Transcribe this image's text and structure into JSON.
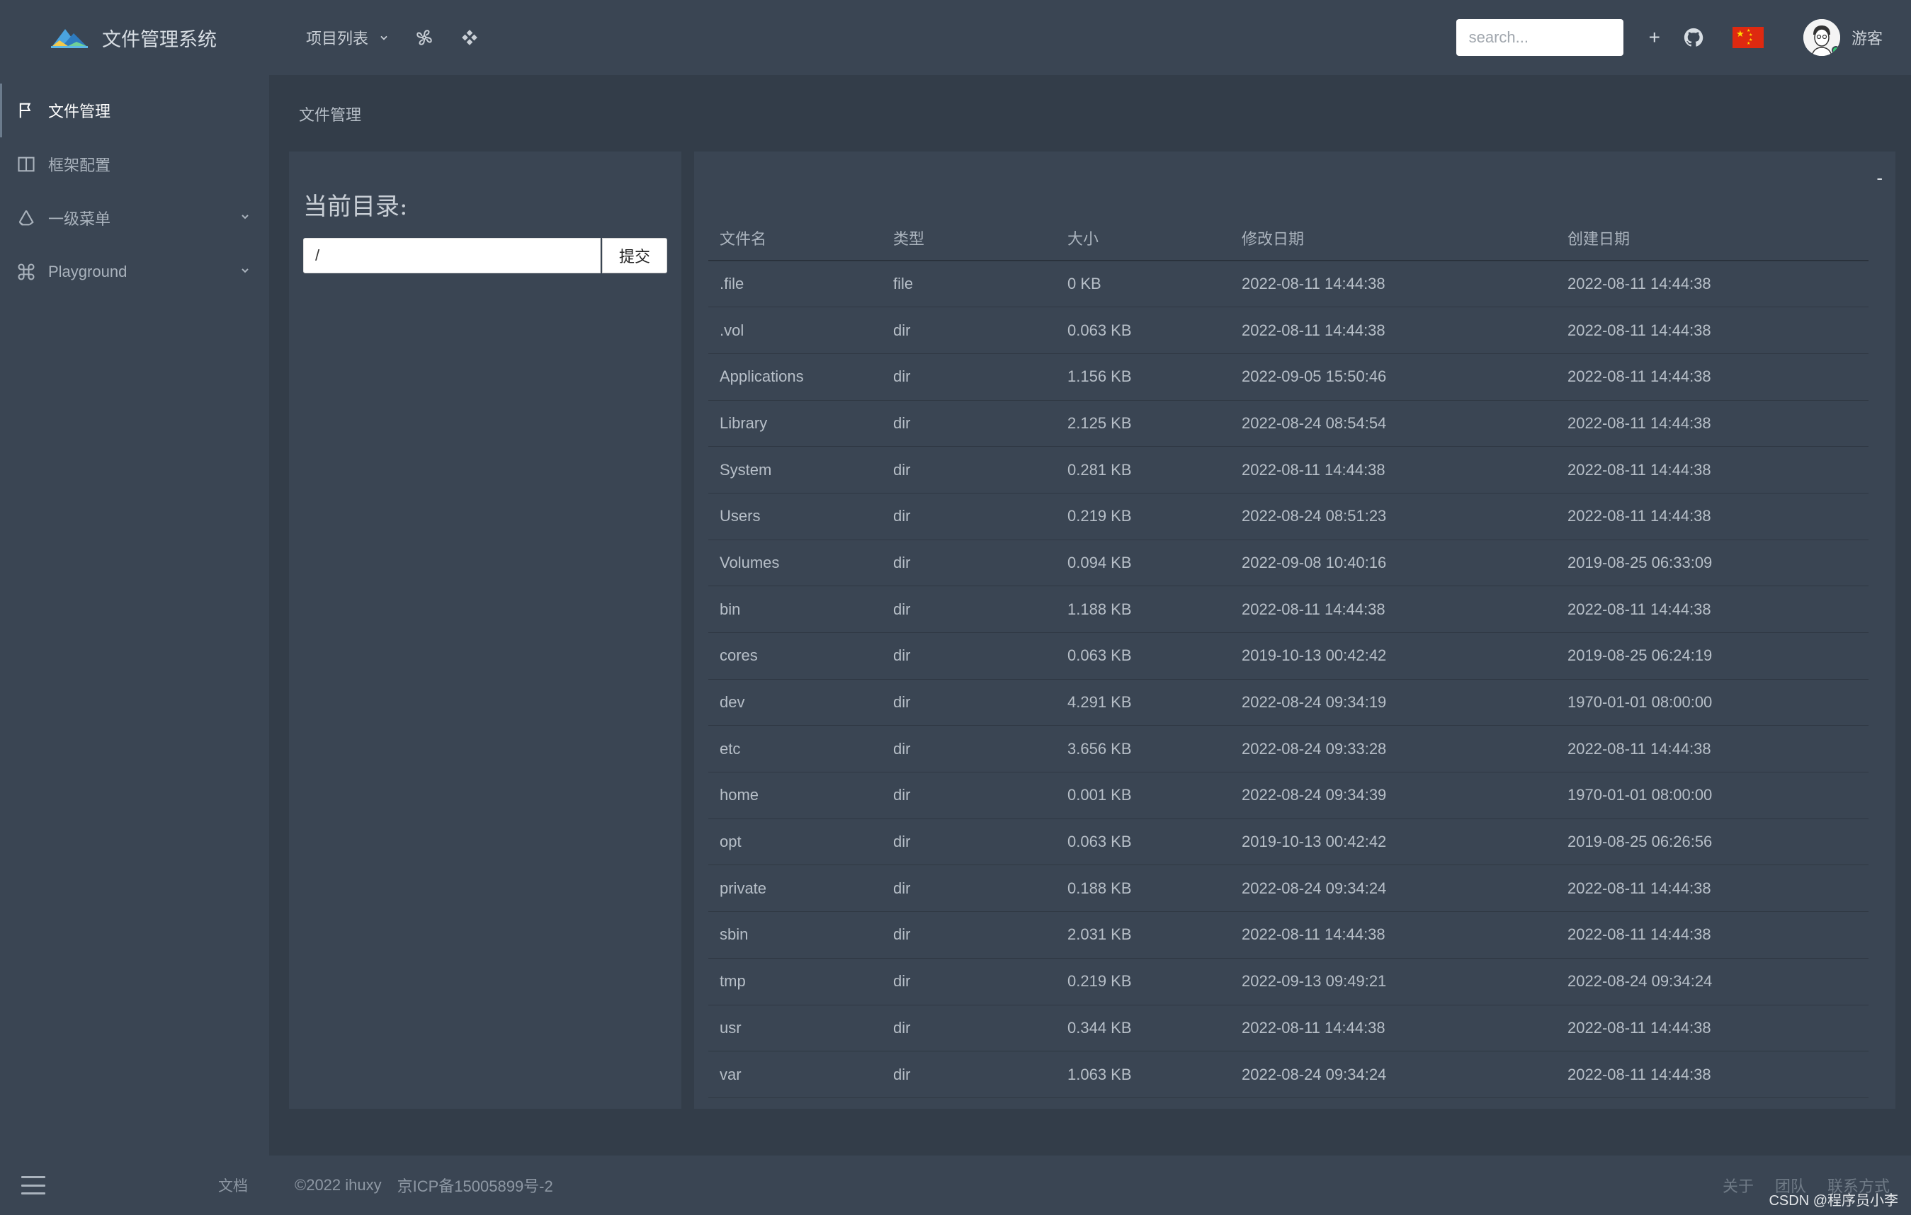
{
  "app": {
    "title": "文件管理系统"
  },
  "sidebar": {
    "items": [
      {
        "label": "文件管理",
        "icon": "flag-icon",
        "active": true
      },
      {
        "label": "框架配置",
        "icon": "layout-icon"
      },
      {
        "label": "一级菜单",
        "icon": "recycle-icon",
        "expandable": true
      },
      {
        "label": "Playground",
        "icon": "command-icon",
        "expandable": true
      }
    ],
    "footer": {
      "menu_icon": "hamburger-icon",
      "doc_label": "文档"
    }
  },
  "topbar": {
    "project_menu_label": "项目列表",
    "search_placeholder": "search...",
    "plus_label": "+",
    "user_name": "游客"
  },
  "breadcrumb": "文件管理",
  "left_panel": {
    "heading": "当前目录:",
    "dir_value": "/",
    "submit_label": "提交"
  },
  "right_panel": {
    "collapse_label": "-"
  },
  "table": {
    "headers": [
      "文件名",
      "类型",
      "大小",
      "修改日期",
      "创建日期"
    ],
    "rows": [
      [
        ".file",
        "file",
        "0 KB",
        "2022-08-11 14:44:38",
        "2022-08-11 14:44:38"
      ],
      [
        ".vol",
        "dir",
        "0.063 KB",
        "2022-08-11 14:44:38",
        "2022-08-11 14:44:38"
      ],
      [
        "Applications",
        "dir",
        "1.156 KB",
        "2022-09-05 15:50:46",
        "2022-08-11 14:44:38"
      ],
      [
        "Library",
        "dir",
        "2.125 KB",
        "2022-08-24 08:54:54",
        "2022-08-11 14:44:38"
      ],
      [
        "System",
        "dir",
        "0.281 KB",
        "2022-08-11 14:44:38",
        "2022-08-11 14:44:38"
      ],
      [
        "Users",
        "dir",
        "0.219 KB",
        "2022-08-24 08:51:23",
        "2022-08-11 14:44:38"
      ],
      [
        "Volumes",
        "dir",
        "0.094 KB",
        "2022-09-08 10:40:16",
        "2019-08-25 06:33:09"
      ],
      [
        "bin",
        "dir",
        "1.188 KB",
        "2022-08-11 14:44:38",
        "2022-08-11 14:44:38"
      ],
      [
        "cores",
        "dir",
        "0.063 KB",
        "2019-10-13 00:42:42",
        "2019-08-25 06:24:19"
      ],
      [
        "dev",
        "dir",
        "4.291 KB",
        "2022-08-24 09:34:19",
        "1970-01-01 08:00:00"
      ],
      [
        "etc",
        "dir",
        "3.656 KB",
        "2022-08-24 09:33:28",
        "2022-08-11 14:44:38"
      ],
      [
        "home",
        "dir",
        "0.001 KB",
        "2022-08-24 09:34:39",
        "1970-01-01 08:00:00"
      ],
      [
        "opt",
        "dir",
        "0.063 KB",
        "2019-10-13 00:42:42",
        "2019-08-25 06:26:56"
      ],
      [
        "private",
        "dir",
        "0.188 KB",
        "2022-08-24 09:34:24",
        "2022-08-11 14:44:38"
      ],
      [
        "sbin",
        "dir",
        "2.031 KB",
        "2022-08-11 14:44:38",
        "2022-08-11 14:44:38"
      ],
      [
        "tmp",
        "dir",
        "0.219 KB",
        "2022-09-13 09:49:21",
        "2022-08-24 09:34:24"
      ],
      [
        "usr",
        "dir",
        "0.344 KB",
        "2022-08-11 14:44:38",
        "2022-08-11 14:44:38"
      ],
      [
        "var",
        "dir",
        "1.063 KB",
        "2022-08-24 09:34:24",
        "2022-08-11 14:44:38"
      ]
    ]
  },
  "footer": {
    "copyright": "©2022 ihuxy",
    "icp": "京ICP备15005899号-2",
    "links": [
      "关于",
      "团队",
      "联系方式"
    ],
    "watermark": "CSDN @程序员小李"
  },
  "colors": {
    "background": "#333d49",
    "panel": "#3a4553",
    "online": "#2ecc71",
    "flag_red": "#de2910",
    "flag_star": "#ffde00"
  }
}
